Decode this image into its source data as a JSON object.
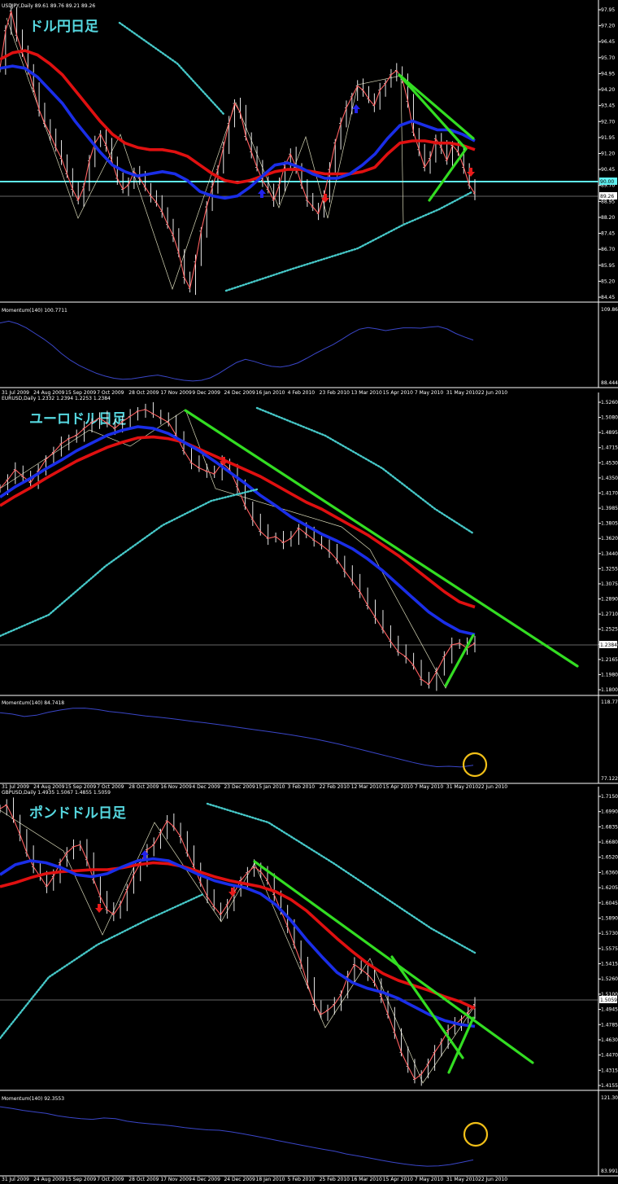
{
  "colors": {
    "background": "#000000",
    "text": "#ffffff",
    "price": "#ffffff",
    "ma_red": "#e01010",
    "ma_blue": "#1a2ee8",
    "ma_thin": "#ff6060",
    "trend_green": "#33dd22",
    "dotted": "#46c8c8",
    "hline_cyan": "#5ff0f0",
    "momentum": "#3a46c8",
    "arrow_red": "#e81b1b",
    "arrow_blue": "#2222ee",
    "circle": "#f2c018",
    "title_cyan": "#56d8e0",
    "separator": "#ffffff"
  },
  "chart_data": [
    {
      "type": "line",
      "symbol_header": "USDJPY,Daily  89.61 89.76 89.21 89.26",
      "title": "ドル円日足",
      "price_axis_labels": [
        "97.95",
        "97.20",
        "96.45",
        "95.70",
        "94.95",
        "94.20",
        "93.45",
        "92.70",
        "91.95",
        "91.20",
        "90.45",
        "89.70",
        "88.95",
        "88.20",
        "87.45",
        "86.70",
        "85.95",
        "85.20",
        "84.45"
      ],
      "current_price_tag": "89.26",
      "hline_tag": "90.00",
      "ylim": [
        84.45,
        97.95
      ],
      "date_labels": [
        "31 Jul 2009",
        "24 Aug 2009",
        "15 Sep 2009",
        "7 Oct 2009",
        "28 Oct 2009",
        "17 Nov 2009",
        "9 Dec 2009",
        "24 Dec 2009",
        "16 Jan 2010",
        "4 Feb 2010",
        "23 Feb 2010",
        "13 Mar 2010",
        "15 Apr 2010",
        "7 May 2010",
        "31 May 2010",
        "22 Jun 2010"
      ],
      "price_series": [
        95.0,
        96.7,
        97.6,
        96.5,
        95.7,
        95.0,
        94.1,
        93.1,
        92.5,
        92.0,
        91.4,
        90.9,
        90.2,
        89.5,
        89.0,
        89.6,
        90.8,
        91.6,
        92.0,
        91.5,
        90.8,
        90.0,
        89.5,
        89.7,
        90.3,
        90.0,
        89.6,
        89.2,
        88.9,
        88.5,
        87.9,
        87.4,
        86.6,
        85.5,
        85.0,
        86.2,
        87.6,
        88.7,
        89.6,
        90.4,
        91.4,
        92.5,
        93.4,
        93.0,
        91.9,
        91.2,
        90.5,
        89.9,
        89.5,
        89.0,
        89.7,
        90.6,
        91.1,
        90.5,
        89.7,
        89.0,
        88.7,
        88.4,
        89.2,
        90.4,
        91.6,
        92.5,
        93.2,
        93.7,
        94.2,
        94.0,
        93.6,
        93.3,
        94.0,
        94.3,
        94.7,
        94.9,
        94.5,
        93.5,
        92.1,
        91.3,
        90.5,
        90.9,
        91.8,
        91.4,
        90.8,
        91.5,
        91.2,
        90.5,
        89.7,
        89.3
      ],
      "red_ma": [
        95.4,
        95.7,
        95.8,
        95.6,
        95.2,
        94.7,
        94.0,
        93.3,
        92.6,
        92.0,
        91.6,
        91.4,
        91.3,
        91.3,
        91.2,
        91.0,
        90.6,
        90.2,
        89.9,
        89.8,
        89.9,
        90.1,
        90.3,
        90.4,
        90.4,
        90.3,
        90.2,
        90.2,
        90.2,
        90.3,
        90.5,
        91.1,
        91.6,
        91.7,
        91.7,
        91.6,
        91.6,
        91.5,
        91.3
      ],
      "blue_ma": [
        95.0,
        95.1,
        95.0,
        94.6,
        94.0,
        93.4,
        92.6,
        91.9,
        91.2,
        90.6,
        90.3,
        90.1,
        90.2,
        90.3,
        90.2,
        89.9,
        89.4,
        89.2,
        89.1,
        89.2,
        89.6,
        90.1,
        90.6,
        90.7,
        90.5,
        90.2,
        90.0,
        90.0,
        90.2,
        90.6,
        91.1,
        91.8,
        92.4,
        92.6,
        92.4,
        92.2,
        92.2,
        92.0,
        91.7
      ],
      "momentum": {
        "label": "Momentum(140) 100.7711",
        "axis_top": "109.8630",
        "axis_bottom": "88.4440",
        "values": [
          106.0,
          106.5,
          105.8,
          104.6,
          103.0,
          101.4,
          99.5,
          97.3,
          95.4,
          93.9,
          92.7,
          91.6,
          90.8,
          90.2,
          89.9,
          90.0,
          90.4,
          90.8,
          91.1,
          90.6,
          90.0,
          89.6,
          89.4,
          89.6,
          90.3,
          91.6,
          93.2,
          94.7,
          95.6,
          95.0,
          94.2,
          93.6,
          93.4,
          93.8,
          94.6,
          95.9,
          97.3,
          98.6,
          99.8,
          101.3,
          102.9,
          104.2,
          104.7,
          104.3,
          103.8,
          104.2,
          104.6,
          104.6,
          104.5,
          104.8,
          105.0,
          104.3,
          103.0,
          102.0,
          101.1
        ]
      },
      "annotations": {
        "arrows": [
          "blue-up",
          "blue-up",
          "red-down",
          "red-down"
        ]
      }
    },
    {
      "type": "line",
      "symbol_header": "EURUSD,Daily  1.2332 1.2394 1.2253 1.2384",
      "title": "ユーロドル日足",
      "price_axis_labels": [
        "1.5260",
        "1.5080",
        "1.4895",
        "1.4715",
        "1.4530",
        "1.4350",
        "1.4170",
        "1.3985",
        "1.3805",
        "1.3620",
        "1.3440",
        "1.3255",
        "1.3075",
        "1.2890",
        "1.2710",
        "1.2525",
        "1.2345",
        "1.2165",
        "1.1980",
        "1.1800"
      ],
      "current_price_tag": "1.2384",
      "ylim": [
        1.18,
        1.526
      ],
      "date_labels": [
        "31 Jul 2009",
        "24 Aug 2009",
        "15 Sep 2009",
        "7 Oct 2009",
        "28 Oct 2009",
        "16 Nov 2009",
        "4 Dec 2009",
        "23 Dec 2009",
        "15 Jan 2010",
        "3 Feb 2010",
        "22 Feb 2010",
        "12 Mar 2010",
        "15 Apr 2010",
        "7 May 2010",
        "31 May 2010",
        "22 Jun 2010"
      ],
      "price_series": [
        1.418,
        1.428,
        1.44,
        1.432,
        1.425,
        1.438,
        1.452,
        1.46,
        1.47,
        1.476,
        1.48,
        1.488,
        1.495,
        1.5,
        1.494,
        1.488,
        1.496,
        1.502,
        1.508,
        1.51,
        1.505,
        1.5,
        1.495,
        1.48,
        1.462,
        1.448,
        1.442,
        1.438,
        1.435,
        1.448,
        1.44,
        1.42,
        1.398,
        1.382,
        1.368,
        1.36,
        1.362,
        1.355,
        1.36,
        1.372,
        1.365,
        1.358,
        1.352,
        1.345,
        1.335,
        1.322,
        1.31,
        1.298,
        1.282,
        1.268,
        1.254,
        1.24,
        1.228,
        1.222,
        1.212,
        1.196,
        1.19,
        1.205,
        1.222,
        1.236,
        1.238,
        1.232,
        1.238
      ],
      "red_ma": [
        1.398,
        1.409,
        1.419,
        1.43,
        1.44,
        1.45,
        1.458,
        1.466,
        1.472,
        1.477,
        1.478,
        1.476,
        1.472,
        1.464,
        1.456,
        1.448,
        1.44,
        1.432,
        1.422,
        1.412,
        1.402,
        1.394,
        1.384,
        1.374,
        1.364,
        1.352,
        1.34,
        1.326,
        1.312,
        1.298,
        1.286,
        1.28
      ],
      "blue_ma": [
        1.408,
        1.42,
        1.43,
        1.441,
        1.451,
        1.462,
        1.471,
        1.48,
        1.486,
        1.49,
        1.488,
        1.482,
        1.472,
        1.462,
        1.45,
        1.437,
        1.424,
        1.41,
        1.398,
        1.385,
        1.375,
        1.365,
        1.357,
        1.348,
        1.336,
        1.322,
        1.306,
        1.29,
        1.274,
        1.262,
        1.252,
        1.248
      ],
      "momentum": {
        "label": "Momentum(140) 84.7418",
        "axis_top": "118.7774",
        "axis_bottom": "77.1227",
        "values": [
          113.0,
          112.3,
          111.0,
          111.7,
          113.3,
          114.5,
          115.4,
          115.5,
          114.8,
          113.7,
          113.0,
          112.2,
          111.3,
          110.7,
          110.0,
          109.2,
          108.3,
          107.6,
          106.7,
          105.8,
          104.9,
          104.0,
          103.1,
          102.2,
          101.2,
          100.1,
          99.0,
          97.6,
          96.2,
          94.6,
          93.0,
          91.4,
          89.8,
          88.2,
          86.6,
          85.2,
          84.3,
          84.5,
          84.1,
          85.0
        ]
      },
      "annotations": {
        "arrows": [
          "red-down"
        ],
        "highlight": "circle-around-latest-momentum"
      }
    },
    {
      "type": "line",
      "symbol_header": "GBPUSD,Daily  1.4935 1.5067 1.4855 1.5059",
      "title": "ポンドドル日足",
      "price_axis_labels": [
        "1.7150",
        "1.6990",
        "1.6835",
        "1.6680",
        "1.6520",
        "1.6360",
        "1.6205",
        "1.6045",
        "1.5890",
        "1.5730",
        "1.5575",
        "1.5415",
        "1.5260",
        "1.5100",
        "1.4945",
        "1.4785",
        "1.4630",
        "1.4470",
        "1.4315",
        "1.4155"
      ],
      "current_price_tag": "1.5059",
      "ylim": [
        1.4155,
        1.715
      ],
      "date_labels": [
        "31 Jul 2009",
        "24 Aug 2009",
        "15 Sep 2009",
        "7 Oct 2009",
        "28 Oct 2009",
        "17 Nov 2009",
        "4 Dec 2009",
        "24 Dec 2009",
        "18 Jan 2010",
        "5 Feb 2010",
        "25 Feb 2010",
        "16 Mar 2010",
        "15 Apr 2010",
        "7 May 2010",
        "31 May 2010",
        "22 Jun 2010"
      ],
      "price_series": [
        1.696,
        1.7,
        1.686,
        1.67,
        1.652,
        1.638,
        1.628,
        1.618,
        1.628,
        1.642,
        1.652,
        1.658,
        1.66,
        1.645,
        1.625,
        1.608,
        1.595,
        1.59,
        1.6,
        1.615,
        1.63,
        1.642,
        1.655,
        1.66,
        1.672,
        1.684,
        1.678,
        1.668,
        1.652,
        1.638,
        1.622,
        1.608,
        1.598,
        1.59,
        1.6,
        1.612,
        1.624,
        1.632,
        1.638,
        1.633,
        1.624,
        1.61,
        1.594,
        1.578,
        1.56,
        1.542,
        1.52,
        1.5,
        1.49,
        1.494,
        1.5,
        1.51,
        1.528,
        1.54,
        1.535,
        1.53,
        1.522,
        1.508,
        1.49,
        1.472,
        1.452,
        1.438,
        1.425,
        1.43,
        1.44,
        1.452,
        1.462,
        1.474,
        1.48,
        1.485,
        1.492,
        1.5
      ],
      "red_ma": [
        1.618,
        1.622,
        1.627,
        1.631,
        1.633,
        1.634,
        1.635,
        1.635,
        1.637,
        1.64,
        1.642,
        1.641,
        1.638,
        1.633,
        1.628,
        1.624,
        1.621,
        1.618,
        1.613,
        1.605,
        1.594,
        1.58,
        1.566,
        1.553,
        1.541,
        1.531,
        1.524,
        1.519,
        1.514,
        1.508,
        1.503,
        1.496
      ],
      "blue_ma": [
        1.63,
        1.64,
        1.644,
        1.642,
        1.637,
        1.63,
        1.628,
        1.631,
        1.638,
        1.644,
        1.646,
        1.644,
        1.637,
        1.63,
        1.624,
        1.62,
        1.617,
        1.611,
        1.6,
        1.584,
        1.565,
        1.548,
        1.532,
        1.522,
        1.516,
        1.512,
        1.506,
        1.498,
        1.49,
        1.484,
        1.48,
        1.478
      ],
      "momentum": {
        "label": "Momentum(140) 92.3553",
        "axis_top": "121.3080",
        "axis_bottom": "83.9919",
        "values": [
          116.8,
          116.0,
          115.0,
          114.2,
          113.5,
          112.3,
          111.5,
          110.9,
          110.5,
          111.2,
          110.9,
          109.6,
          108.8,
          108.3,
          107.8,
          107.2,
          106.4,
          105.8,
          105.3,
          105.1,
          104.3,
          103.4,
          102.3,
          101.2,
          100.0,
          98.9,
          97.8,
          96.7,
          95.6,
          94.6,
          93.3,
          92.3,
          91.3,
          90.2,
          89.2,
          88.3,
          87.6,
          87.2,
          87.3,
          88.0,
          89.1,
          90.3
        ]
      },
      "annotations": {
        "arrows": [
          "red-down",
          "blue-up",
          "red-down"
        ],
        "highlight": "circle-around-latest-momentum"
      }
    }
  ]
}
